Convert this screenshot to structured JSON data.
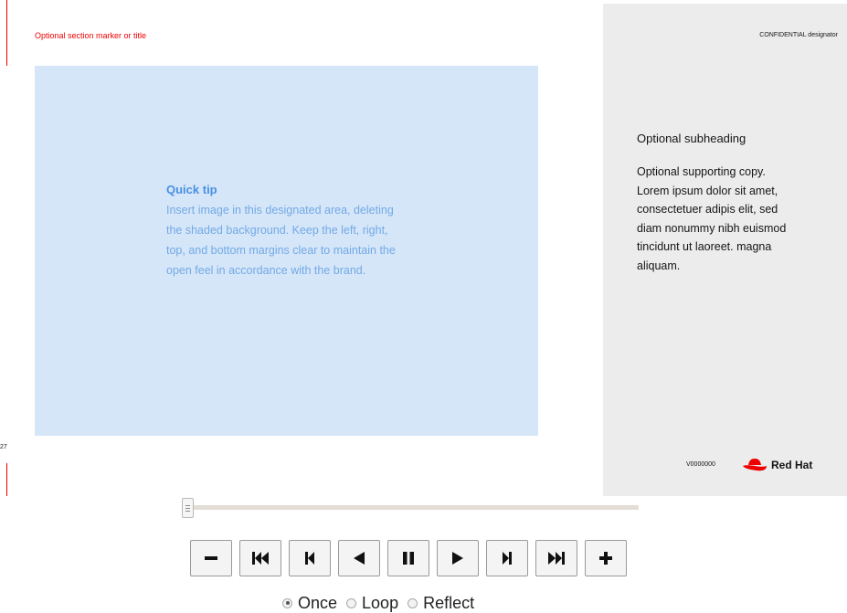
{
  "slide": {
    "section_marker": "Optional section marker or title",
    "page_number": "27",
    "tip": {
      "title": "Quick tip",
      "body": "Insert image in this designated area, deleting the shaded background. Keep the left, right, top, and bottom margins clear to maintain the open feel in accordance with the brand."
    },
    "panel": {
      "confidential": "CONFIDENTIAL designator",
      "subheading": "Optional subheading",
      "supporting_copy": "Optional supporting copy. Lorem ipsum dolor sit amet, consectetuer adipis elit, sed diam nonummy nibh euismod tincidunt ut laoreet. magna aliquam.",
      "version": "V0000000",
      "logo_text": "Red Hat"
    },
    "colors": {
      "accent_red": "#ee0000",
      "image_area": "#d5e6f8",
      "tip_text": "#73a9e6",
      "panel_bg": "#ececec"
    }
  },
  "player": {
    "slider_position": 0,
    "buttons": [
      {
        "name": "zoom-out-button",
        "icon": "minus-icon"
      },
      {
        "name": "first-frame-button",
        "icon": "skip-to-start-icon"
      },
      {
        "name": "step-back-button",
        "icon": "step-back-icon"
      },
      {
        "name": "play-reverse-button",
        "icon": "reverse-play-icon"
      },
      {
        "name": "pause-button",
        "icon": "pause-icon"
      },
      {
        "name": "play-button",
        "icon": "play-icon"
      },
      {
        "name": "step-forward-button",
        "icon": "step-forward-icon"
      },
      {
        "name": "last-frame-button",
        "icon": "skip-to-end-icon"
      },
      {
        "name": "zoom-in-button",
        "icon": "plus-icon"
      }
    ],
    "modes": [
      {
        "label": "Once",
        "checked": true
      },
      {
        "label": "Loop",
        "checked": false
      },
      {
        "label": "Reflect",
        "checked": false
      }
    ]
  }
}
